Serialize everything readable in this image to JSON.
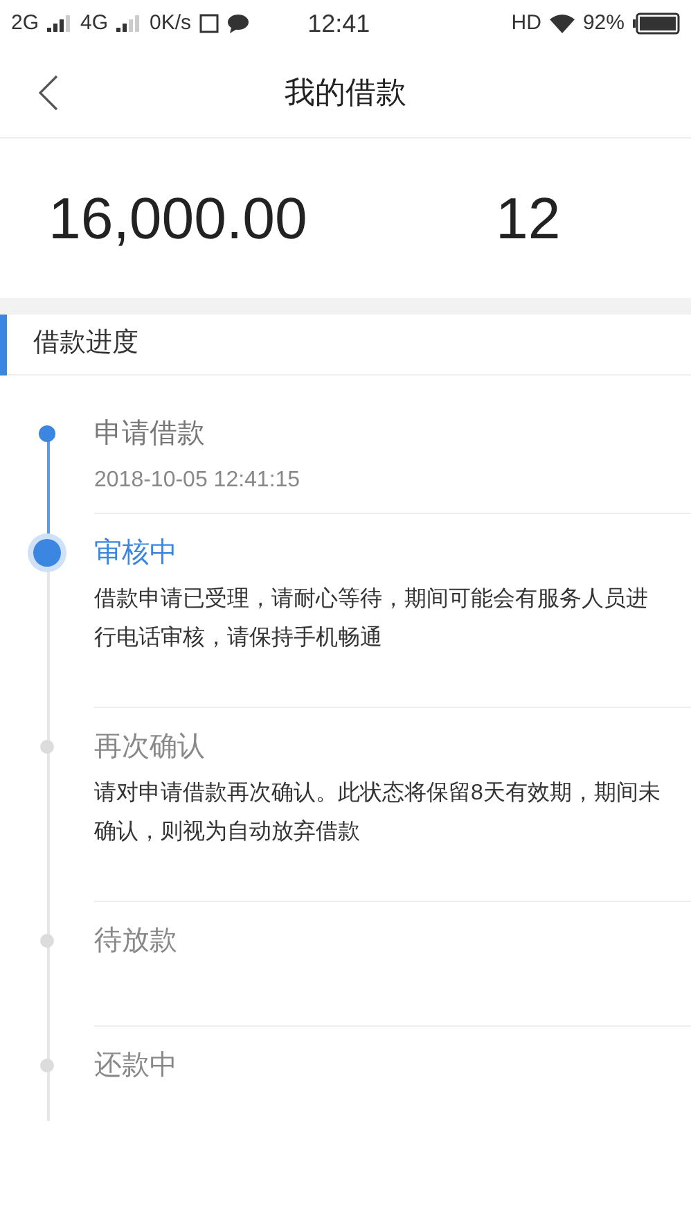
{
  "status_bar": {
    "left": [
      "2G",
      "4G",
      "0K/s"
    ],
    "time": "12:41",
    "hd": "HD",
    "battery": "92%"
  },
  "header": {
    "title": "我的借款"
  },
  "summary": {
    "amount": "16,000.00",
    "periods": "12"
  },
  "progress": {
    "title": "借款进度",
    "steps": [
      {
        "title": "申请借款",
        "detail": "2018-10-05 12:41:15",
        "done": true,
        "current": false
      },
      {
        "title": "审核中",
        "detail": "借款申请已受理，请耐心等待，期间可能会有服务人员进行电话审核，请保持手机畅通",
        "done": false,
        "current": true
      },
      {
        "title": "再次确认",
        "detail": "请对申请借款再次确认。此状态将保留8天有效期，期间未确认，则视为自动放弃借款",
        "done": false,
        "current": false
      },
      {
        "title": "待放款",
        "done": false,
        "current": false
      },
      {
        "title": "还款中",
        "done": false,
        "current": false
      }
    ]
  }
}
